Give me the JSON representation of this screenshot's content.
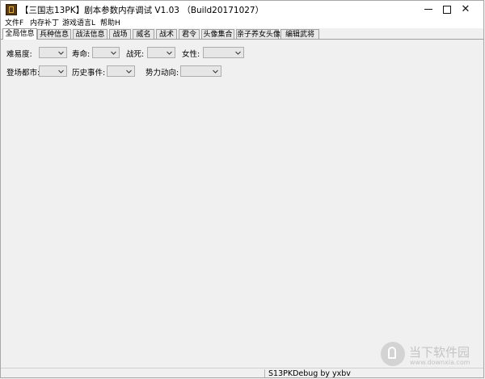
{
  "window": {
    "title": "【三国志13PK】剧本参数内存调试 V1.03 （Build20171027）",
    "icon": "app-icon"
  },
  "menu": [
    {
      "label": "文件F"
    },
    {
      "label": "内存补丁"
    },
    {
      "label": "游戏语言L"
    },
    {
      "label": "帮助H"
    }
  ],
  "tabs": [
    {
      "label": "全局信息",
      "active": true
    },
    {
      "label": "兵种信息"
    },
    {
      "label": "战法信息"
    },
    {
      "label": "战场"
    },
    {
      "label": "威名"
    },
    {
      "label": "战术"
    },
    {
      "label": "君令"
    },
    {
      "label": "头像集合"
    },
    {
      "label": "亲子养女头像"
    },
    {
      "label": "编辑武将"
    }
  ],
  "form": {
    "row1": [
      {
        "label": "难易度:",
        "value": ""
      },
      {
        "label": "寿命:",
        "value": ""
      },
      {
        "label": "战死:",
        "value": ""
      },
      {
        "label": "女性:",
        "value": ""
      }
    ],
    "row2": [
      {
        "label": "登场都市:",
        "value": ""
      },
      {
        "label": "历史事件:",
        "value": ""
      },
      {
        "label": "势力动向:",
        "value": ""
      }
    ]
  },
  "status": {
    "text": "S13PKDebug by yxbv"
  },
  "watermark": {
    "name": "当下软件园",
    "url": "www.downxia.com"
  },
  "colors": {
    "window_bg": "#f0f0f0",
    "title_bg": "#ffffff",
    "combo_bg": "#e6e6e6"
  }
}
